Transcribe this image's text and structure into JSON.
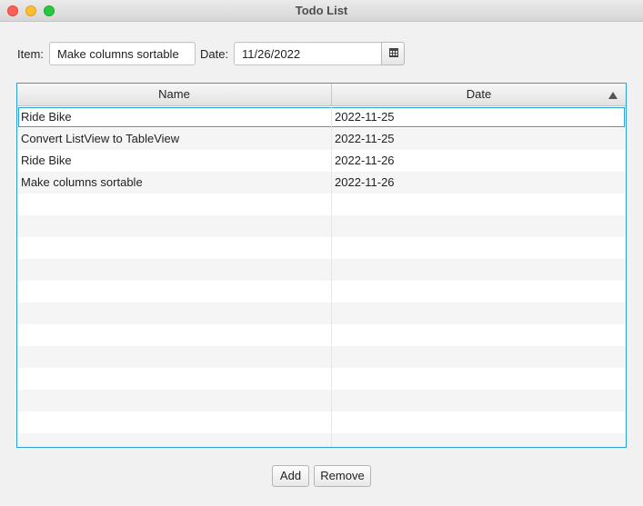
{
  "window": {
    "title": "Todo List"
  },
  "form": {
    "item_label": "Item:",
    "item_value": "Make columns sortable",
    "date_label": "Date:",
    "date_value": "11/26/2022"
  },
  "table": {
    "columns": [
      "Name",
      "Date"
    ],
    "sort_column": "Date",
    "sort_direction": "ascending",
    "rows": [
      {
        "name": "Ride Bike",
        "date": "2022-11-25"
      },
      {
        "name": "Convert ListView to TableView",
        "date": "2022-11-25"
      },
      {
        "name": "Ride Bike",
        "date": "2022-11-26"
      },
      {
        "name": "Make columns sortable",
        "date": "2022-11-26"
      }
    ],
    "focused_row": 0
  },
  "buttons": {
    "add_label": "Add",
    "remove_label": "Remove"
  },
  "colors": {
    "focus_border": "#2a9fd8"
  },
  "icons": {
    "date_picker": "calendar-icon",
    "sort": "sort-ascending-icon"
  }
}
